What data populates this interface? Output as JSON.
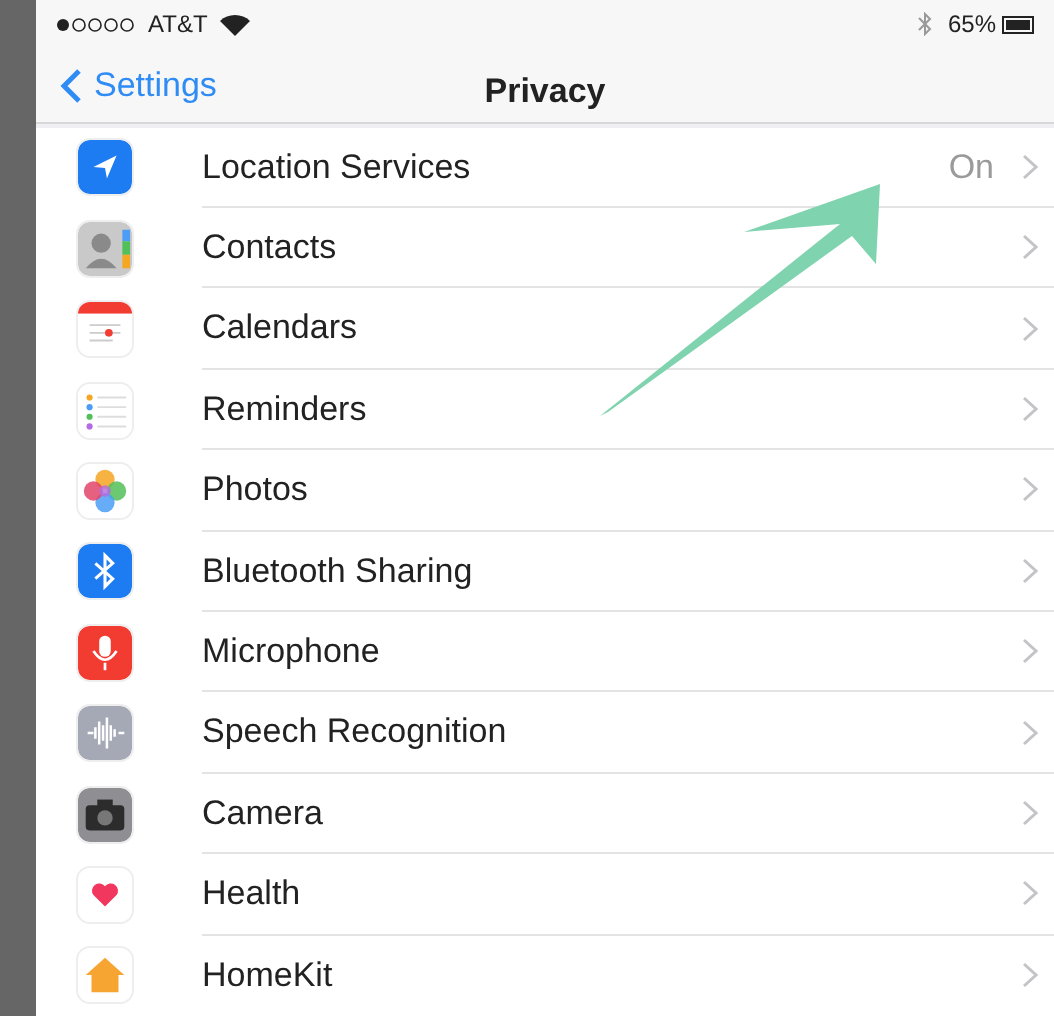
{
  "status_bar": {
    "carrier": "AT&T",
    "battery": "65%"
  },
  "nav": {
    "back": "Settings",
    "title": "Privacy"
  },
  "rows": [
    {
      "kind": "location",
      "label": "Location Services",
      "value": "On"
    },
    {
      "kind": "contacts",
      "label": "Contacts"
    },
    {
      "kind": "calendars",
      "label": "Calendars"
    },
    {
      "kind": "reminders",
      "label": "Reminders"
    },
    {
      "kind": "photos",
      "label": "Photos"
    },
    {
      "kind": "bluetooth",
      "label": "Bluetooth Sharing"
    },
    {
      "kind": "microphone",
      "label": "Microphone"
    },
    {
      "kind": "speech",
      "label": "Speech Recognition"
    },
    {
      "kind": "camera",
      "label": "Camera"
    },
    {
      "kind": "health",
      "label": "Health"
    },
    {
      "kind": "homekit",
      "label": "HomeKit"
    }
  ]
}
